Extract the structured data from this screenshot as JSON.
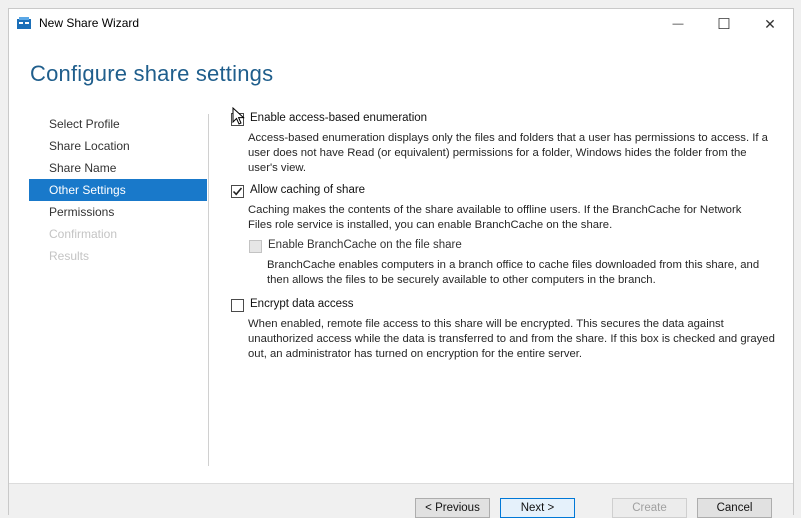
{
  "window": {
    "title": "New Share Wizard",
    "minimize_glyph": "—",
    "maximize_glyph": "☐",
    "close_glyph": "✕"
  },
  "header": {
    "title": "Configure share settings"
  },
  "nav": {
    "items": [
      {
        "label": "Select Profile",
        "state": "normal"
      },
      {
        "label": "Share Location",
        "state": "normal"
      },
      {
        "label": "Share Name",
        "state": "normal"
      },
      {
        "label": "Other Settings",
        "state": "active"
      },
      {
        "label": "Permissions",
        "state": "normal"
      },
      {
        "label": "Confirmation",
        "state": "disabled"
      },
      {
        "label": "Results",
        "state": "disabled"
      }
    ]
  },
  "options": {
    "access_based_enumeration": {
      "label": "Enable access-based enumeration",
      "checked": false,
      "description": "Access-based enumeration displays only the files and folders that a user has permissions to access. If a user does not have Read (or equivalent) permissions for a folder, Windows hides the folder from the user's view."
    },
    "allow_caching": {
      "label": "Allow caching of share",
      "checked": true,
      "description": "Caching makes the contents of the share available to offline users. If the BranchCache for Network Files role service is installed, you can enable BranchCache on the share."
    },
    "branchcache": {
      "label": "Enable BranchCache on the file share",
      "checked": false,
      "enabled": false,
      "description": "BranchCache enables computers in a branch office to cache files downloaded from this share, and then allows the files to be securely available to other computers in the branch."
    },
    "encrypt": {
      "label": "Encrypt data access",
      "checked": false,
      "description": "When enabled, remote file access to this share will be encrypted. This secures the data against unauthorized access while the data is transferred to and from the share. If this box is checked and grayed out, an administrator has turned on encryption for the entire server."
    }
  },
  "footer": {
    "previous": "< Previous",
    "next": "Next >",
    "create": "Create",
    "cancel": "Cancel"
  },
  "icons": {
    "app": "server-share-icon",
    "check": "checkmark-icon",
    "cursor": "mouse-pointer-icon"
  }
}
